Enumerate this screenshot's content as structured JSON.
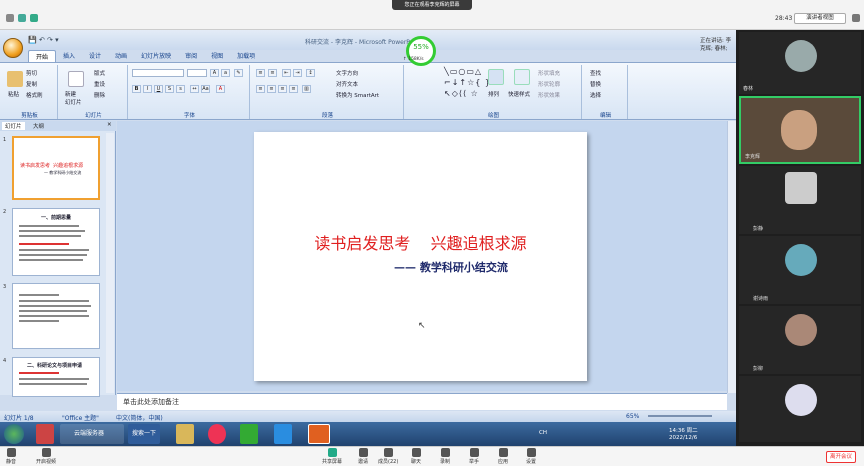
{
  "meeting": {
    "share_banner": "您正在观看李克辉的屏幕",
    "clock": "28:43",
    "view_button": "演讲者视图",
    "speaking": "正在讲话: 李克辉; 春林;"
  },
  "ppt": {
    "title": "科研交流 - 李克辉 - Microsoft PowerPoint",
    "tabs": [
      "开始",
      "插入",
      "设计",
      "动画",
      "幻灯片放映",
      "审阅",
      "视图",
      "加载项"
    ],
    "groups": [
      "剪贴板",
      "幻灯片",
      "字体",
      "段落",
      "绘图",
      "编辑"
    ],
    "clipboard": {
      "paste": "粘贴",
      "cut": "剪切",
      "copy": "复制",
      "format_painter": "格式刷"
    },
    "slides": {
      "new": "新建\n幻灯片",
      "layout": "版式",
      "reset": "重设",
      "delete": "删除"
    },
    "paragraph": {
      "text_direction": "文字方向",
      "align_text": "对齐文本",
      "smartart": "转换为 SmartArt"
    },
    "drawing": {
      "arrange": "排列",
      "quick_styles": "快速样式",
      "fill": "形状填充",
      "outline": "形状轮廓",
      "effects": "形状效果"
    },
    "editing": {
      "find": "查找",
      "replace": "替换",
      "select": "选择"
    },
    "net": {
      "percent": "55%",
      "rate": "↑ 158K/s"
    },
    "panel_tabs": [
      "幻灯片",
      "大纲"
    ],
    "thumbs": [
      {
        "num": "1",
        "title": "读书启发思考  兴趣追根求源",
        "sub": "— 教学科研小结交流"
      },
      {
        "num": "2",
        "title": "一、前期思量"
      },
      {
        "num": "3"
      },
      {
        "num": "4",
        "title": "二、科研论文与项目申请"
      }
    ],
    "slide": {
      "title": "读书启发思考    兴趣追根求源",
      "subtitle": "—— 教学科研小结交流"
    },
    "notes": "单击此处添加备注",
    "status": {
      "slide": "幻灯片 1/8",
      "theme": "\"Office 主题\"",
      "lang": "中文(简体，中国)",
      "zoom": "65%"
    }
  },
  "taskbar": {
    "item": "云端服务器",
    "search": "搜索一下",
    "time": "14:36 周二",
    "date": "2022/12/6",
    "ime": "CH"
  },
  "participants": [
    {
      "name": "春林"
    },
    {
      "name": "李克辉"
    },
    {
      "name": "彭静"
    },
    {
      "name": "谢诗雨"
    },
    {
      "name": "彭柳"
    }
  ],
  "toolbar": {
    "mute": "静音",
    "video": "开启视频",
    "share": "共享屏幕",
    "invite": "邀请",
    "members": "成员(22)",
    "chat": "聊天",
    "record": "录制",
    "raise": "举手",
    "apps": "应用",
    "settings": "设置",
    "end": "离开会议"
  }
}
